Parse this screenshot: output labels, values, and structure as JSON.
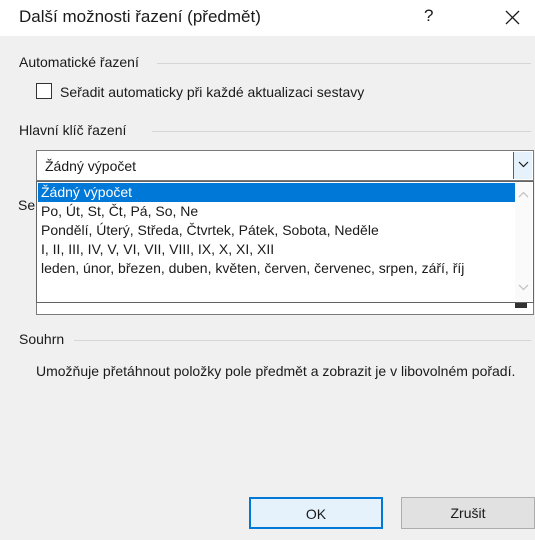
{
  "dialog": {
    "title": "Další možnosti řazení (předmět)",
    "help_label": "?",
    "close_icon": "close-icon"
  },
  "auto_sort": {
    "section_label": "Automatické řazení",
    "checkbox_label": "Seřadit automaticky při každé aktualizaci sestavy",
    "checked": false
  },
  "main_key": {
    "section_label": "Hlavní klíč řazení",
    "selected_value": "Žádný výpočet",
    "options": [
      "Žádný výpočet",
      "Po, Út, St, Čt, Pá, So, Ne",
      "Pondělí, Úterý, Středa, Čtvrtek, Pátek, Sobota, Neděle",
      "I, II, III, IV, V, VI, VII, VIII, IX, X, XI, XII",
      "leden, únor, březen, duben, květen, červen, červenec, srpen, září, říj"
    ],
    "selected_index": 0
  },
  "partially_hidden": {
    "label_fragment": "Se"
  },
  "summary": {
    "section_label": "Souhrn",
    "text": "Umožňuje přetáhnout položky pole předmět a zobrazit je v libovolném pořadí."
  },
  "buttons": {
    "ok": "OK",
    "cancel": "Zrušit"
  },
  "colors": {
    "accent": "#0078d7",
    "dialog_bg": "#f0f0f0",
    "selection_text": "#ffffff"
  }
}
